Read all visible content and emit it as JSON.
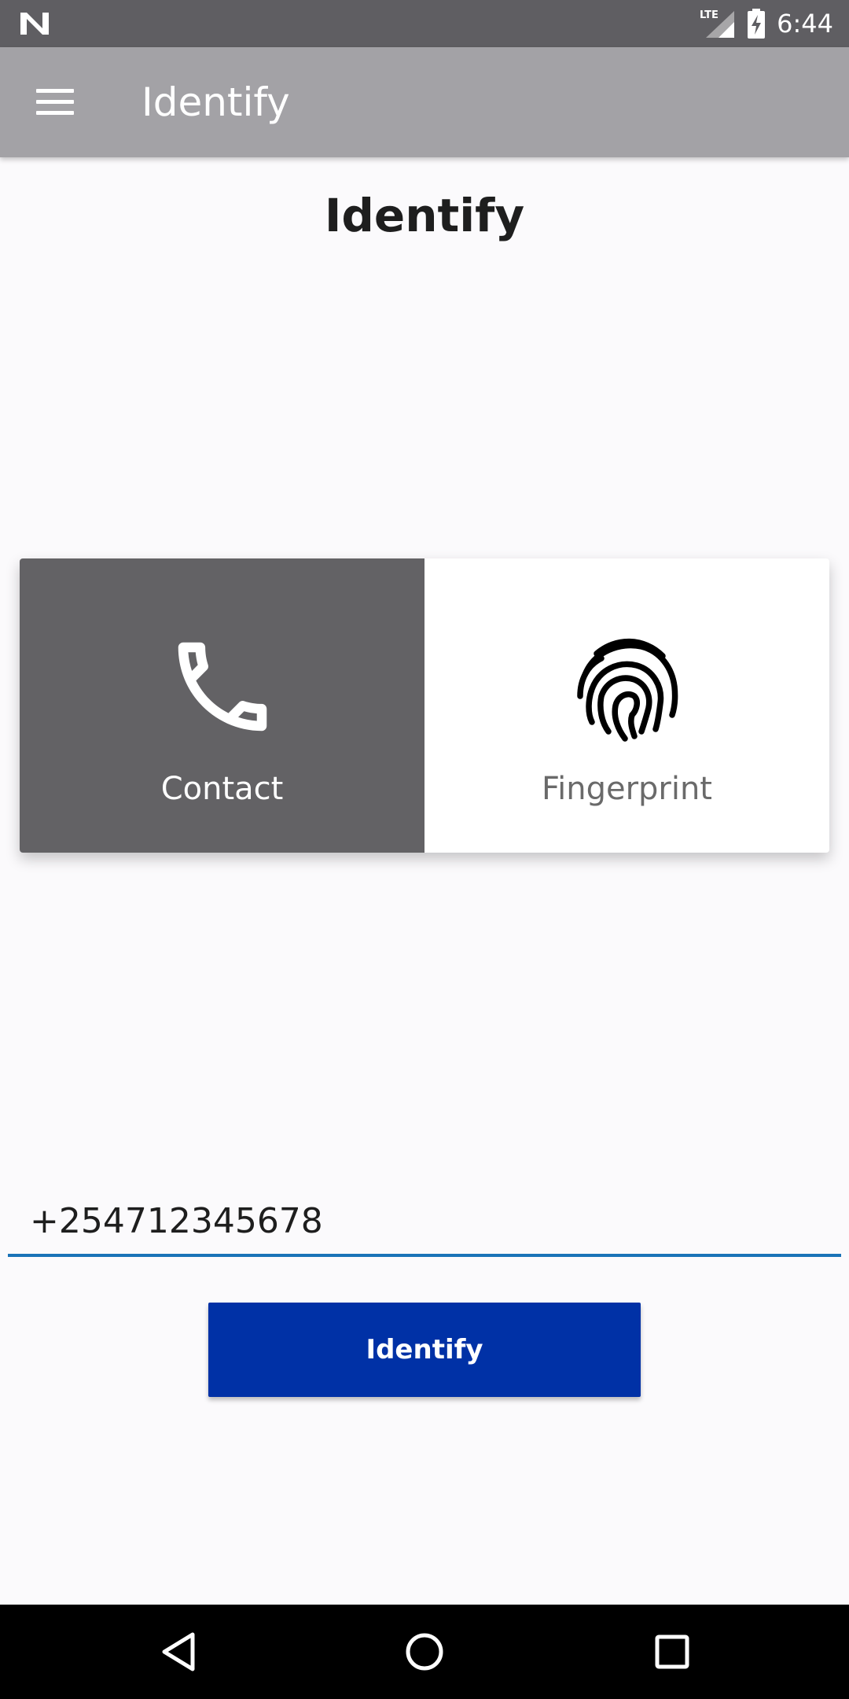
{
  "status_bar": {
    "time": "6:44",
    "network_label": "LTE",
    "left_icon": "n-notification-icon",
    "icons": [
      "lte-signal-icon",
      "battery-charging-icon"
    ]
  },
  "app_bar": {
    "title": "Identify",
    "menu_icon": "hamburger-menu-icon"
  },
  "page": {
    "title": "Identify"
  },
  "identify_options": [
    {
      "label": "Contact",
      "icon": "phone-icon",
      "selected": true
    },
    {
      "label": "Fingerprint",
      "icon": "fingerprint-icon",
      "selected": false
    }
  ],
  "phone_input": {
    "value": "+254712345678"
  },
  "identify_button": {
    "label": "Identify"
  },
  "nav_bar": {
    "icons": [
      "back-icon",
      "home-icon",
      "recents-icon"
    ]
  },
  "colors": {
    "status_bar": "#5f5e62",
    "app_bar": "#a3a2a6",
    "selected_segment": "#636265",
    "input_underline": "#1a73b8",
    "primary_button": "#0031a6",
    "background": "#fbfafc"
  }
}
